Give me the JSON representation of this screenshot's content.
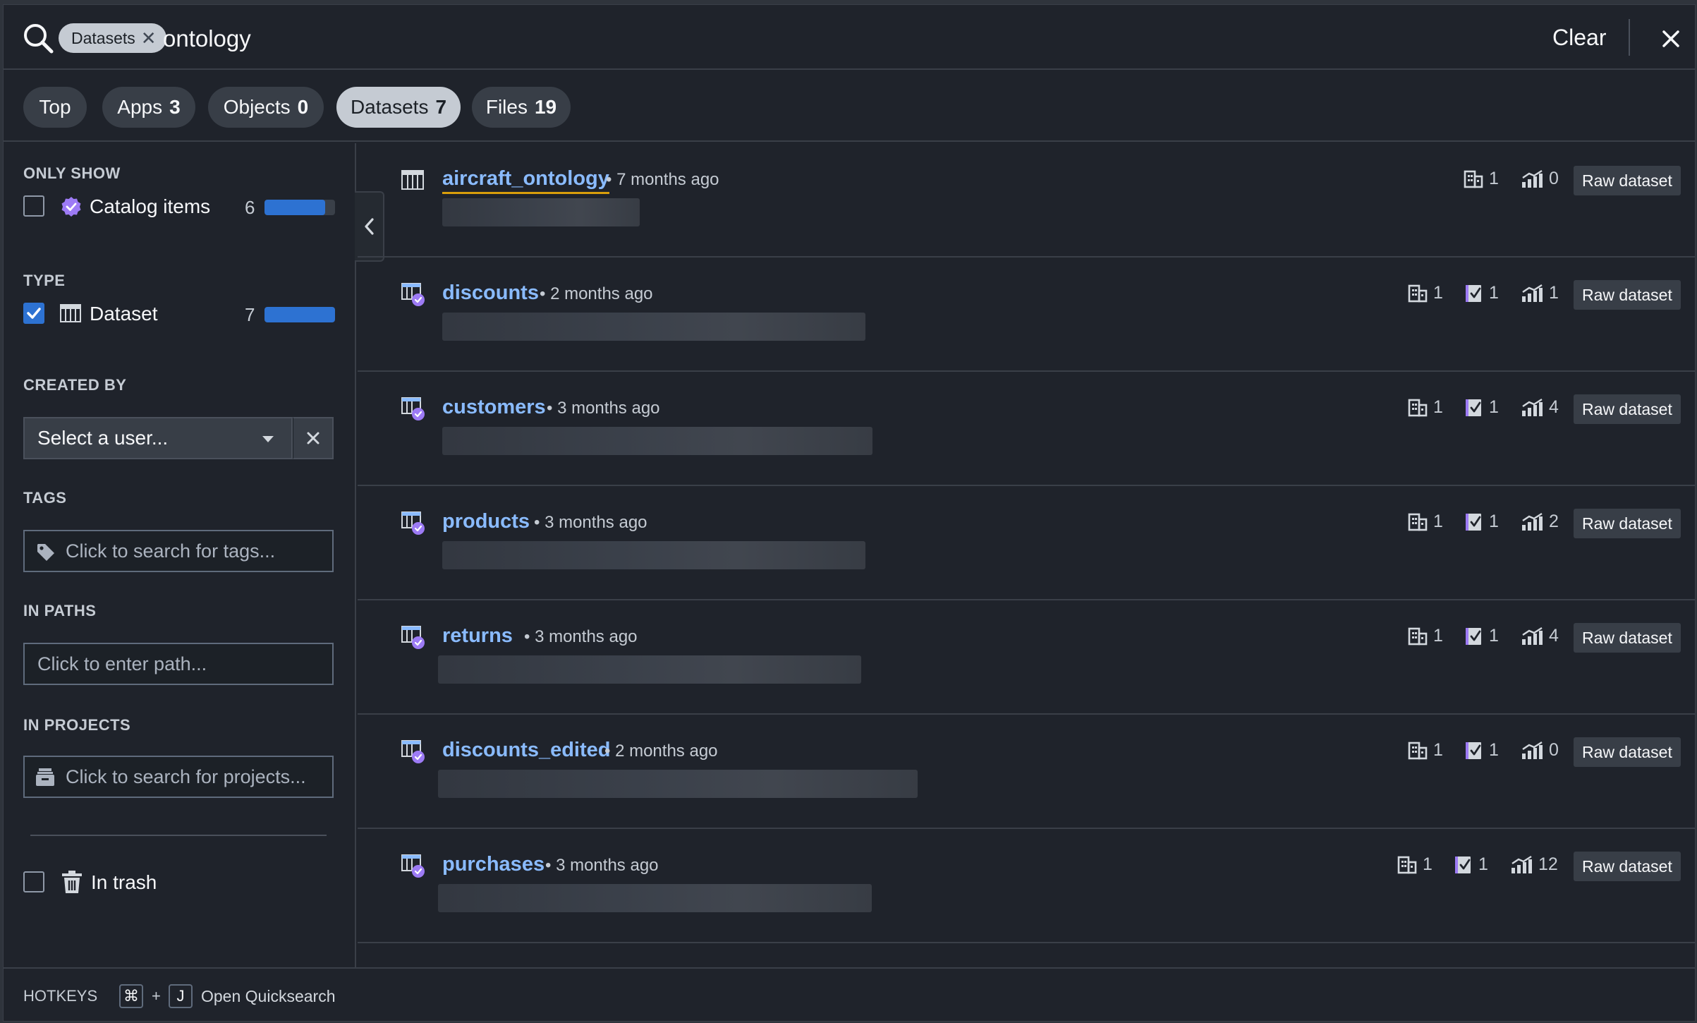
{
  "search": {
    "filter_chip": "Datasets",
    "query": "ontology",
    "clear_label": "Clear"
  },
  "tabs": [
    {
      "label": "Top",
      "count": ""
    },
    {
      "label": "Apps",
      "count": "3"
    },
    {
      "label": "Objects",
      "count": "0"
    },
    {
      "label": "Datasets",
      "count": "7",
      "active": true
    },
    {
      "label": "Files",
      "count": "19"
    }
  ],
  "filters": {
    "only_show": {
      "heading": "ONLY SHOW",
      "label": "Catalog items",
      "count": "6",
      "fraction": 0.86,
      "checked": false
    },
    "type": {
      "heading": "TYPE",
      "label": "Dataset",
      "count": "7",
      "fraction": 1.0,
      "checked": true
    },
    "created_by": {
      "heading": "CREATED BY",
      "placeholder": "Select a user..."
    },
    "tags": {
      "heading": "TAGS",
      "placeholder": "Click to search for tags..."
    },
    "in_paths": {
      "heading": "IN PATHS",
      "placeholder": "Click to enter path..."
    },
    "in_projects": {
      "heading": "IN PROJECTS",
      "placeholder": "Click to search for projects..."
    },
    "in_trash": {
      "label": "In trash",
      "checked": false
    }
  },
  "results": [
    {
      "name": "aircraft_ontology",
      "time": "7 months ago",
      "orgs": "1",
      "checks": "",
      "lineage": "0",
      "badge": "Raw dataset",
      "catalog": false
    },
    {
      "name": "discounts",
      "time": "2 months ago",
      "orgs": "1",
      "checks": "1",
      "lineage": "1",
      "badge": "Raw dataset",
      "catalog": true
    },
    {
      "name": "customers",
      "time": "3 months ago",
      "orgs": "1",
      "checks": "1",
      "lineage": "4",
      "badge": "Raw dataset",
      "catalog": true
    },
    {
      "name": "products",
      "time": "3 months ago",
      "orgs": "1",
      "checks": "1",
      "lineage": "2",
      "badge": "Raw dataset",
      "catalog": true
    },
    {
      "name": "returns",
      "time": "3 months ago",
      "orgs": "1",
      "checks": "1",
      "lineage": "4",
      "badge": "Raw dataset",
      "catalog": true
    },
    {
      "name": "discounts_edited",
      "time": "2 months ago",
      "orgs": "1",
      "checks": "1",
      "lineage": "0",
      "badge": "Raw dataset",
      "catalog": true
    },
    {
      "name": "purchases",
      "time": "3 months ago",
      "orgs": "1",
      "checks": "1",
      "lineage": "12",
      "badge": "Raw dataset",
      "catalog": true
    }
  ],
  "footer": {
    "label": "HOTKEYS",
    "key_1": "⌘",
    "plus": "+",
    "key_2": "J",
    "action": "Open Quicksearch"
  },
  "colors": {
    "accent_blue": "#2d72d2",
    "link_blue": "#8abbff",
    "catalog_purple": "#9d7bf5",
    "highlight_gold": "#d99e0b"
  }
}
